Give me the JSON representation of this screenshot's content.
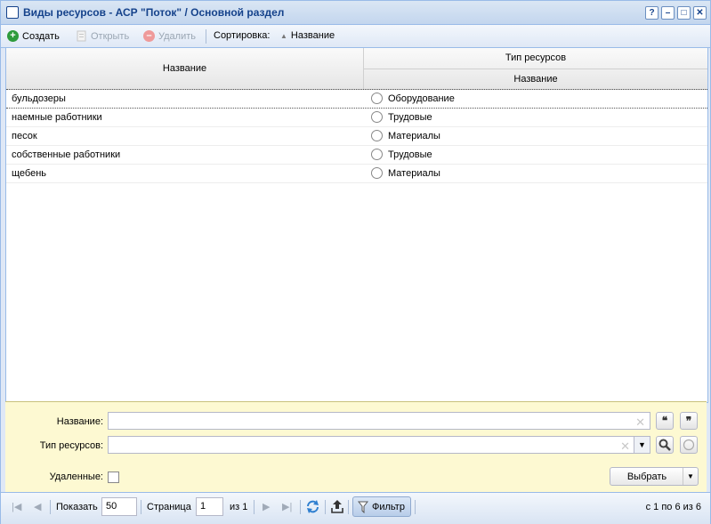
{
  "window": {
    "title": "Виды ресурсов - АСР \"Поток\" / Основной раздел",
    "buttons": [
      "?",
      "–",
      "□",
      "✕"
    ]
  },
  "toolbar": {
    "create": "Создать",
    "open": "Открыть",
    "delete": "Удалить",
    "sort_label": "Сортировка:",
    "sort_value": "Название"
  },
  "grid": {
    "col_name": "Название",
    "col_group": "Тип ресурсов",
    "col_type_name": "Название",
    "rows": [
      {
        "name": "бульдозеры",
        "type": "Оборудование"
      },
      {
        "name": "наемные работники",
        "type": "Трудовые"
      },
      {
        "name": "песок",
        "type": "Материалы"
      },
      {
        "name": "собственные работники",
        "type": "Трудовые"
      },
      {
        "name": "щебень",
        "type": "Материалы"
      }
    ]
  },
  "filter": {
    "name_label": "Название:",
    "name_value": "",
    "type_label": "Тип ресурсов:",
    "type_value": "",
    "deleted_label": "Удаленные:",
    "choose": "Выбрать"
  },
  "pager": {
    "show_label": "Показать",
    "page_size": "50",
    "page_label": "Страница",
    "page_value": "1",
    "of": "из 1",
    "filter": "Фильтр",
    "summary": "с 1 по 6 из 6"
  },
  "colors": {
    "title": "#15428b",
    "create_icon": "#2e9b3c",
    "delete_icon": "#e25b5b",
    "filter_bg": "#fdf9d2"
  }
}
